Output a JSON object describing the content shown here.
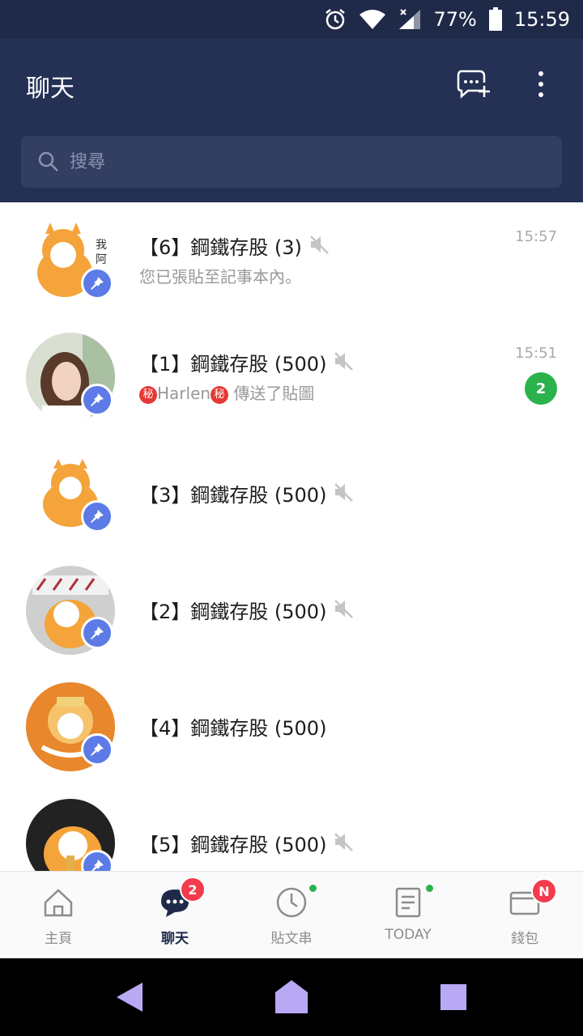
{
  "status_bar": {
    "battery": "77%",
    "time": "15:59"
  },
  "header": {
    "title": "聊天",
    "new_chat_icon": "chat-plus-icon",
    "more_icon": "vertical-dots-icon"
  },
  "search": {
    "placeholder": "搜尋"
  },
  "chats": [
    {
      "title": "【6】鋼鐵存股 (3)",
      "preview": "您已張貼至記事本內。",
      "time": "15:57",
      "muted": true,
      "pinned": true,
      "unread": null
    },
    {
      "title": "【1】鋼鐵存股 (500)",
      "preview_parts": [
        "秘",
        "Harlen",
        "秘",
        " 傳送了貼圖"
      ],
      "time": "15:51",
      "muted": true,
      "pinned": true,
      "unread": "2"
    },
    {
      "title": "【3】鋼鐵存股 (500)",
      "muted": true,
      "pinned": true
    },
    {
      "title": "【2】鋼鐵存股 (500)",
      "muted": true,
      "pinned": true
    },
    {
      "title": "【4】鋼鐵存股 (500)",
      "muted": false,
      "pinned": true
    },
    {
      "title": "【5】鋼鐵存股 (500)",
      "muted": true,
      "pinned": true
    }
  ],
  "bottom_nav": [
    {
      "label": "主頁",
      "icon": "home-icon"
    },
    {
      "label": "聊天",
      "icon": "chat-bubble-icon",
      "badge": "2",
      "active": true
    },
    {
      "label": "貼文串",
      "icon": "clock-icon",
      "dot": true
    },
    {
      "label": "TODAY",
      "icon": "news-icon",
      "dot": true
    },
    {
      "label": "錢包",
      "icon": "wallet-icon",
      "badge": "N"
    }
  ],
  "colors": {
    "header_bg": "#243054",
    "status_bg": "#1f2a49",
    "pin_blue": "#5c7be6",
    "unread_green": "#2bb24c",
    "badge_red": "#f23c4e",
    "system_nav_icon": "#b9a9f5"
  }
}
